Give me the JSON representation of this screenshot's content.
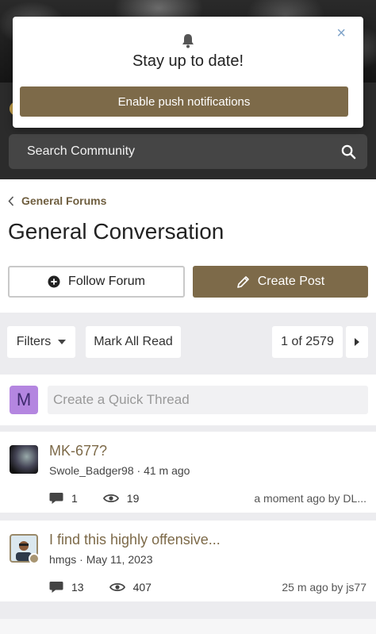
{
  "popup": {
    "title": "Stay up to date!",
    "enable_label": "Enable push notifications",
    "close_glyph": "×"
  },
  "header": {
    "search_label": "Search Community"
  },
  "breadcrumb": {
    "parent": "General Forums"
  },
  "page": {
    "title": "General Conversation"
  },
  "actions": {
    "follow_label": "Follow Forum",
    "create_label": "Create Post"
  },
  "toolbar": {
    "filters_label": "Filters",
    "mark_read_label": "Mark All Read",
    "pagination": "1 of 2579"
  },
  "quick_thread": {
    "avatar_letter": "M",
    "placeholder": "Create a Quick Thread"
  },
  "threads": [
    {
      "title": "MK-677?",
      "author": "Swole_Badger98",
      "time": "41 m ago",
      "replies": "1",
      "views": "19",
      "last_activity": "a moment ago by DL..."
    },
    {
      "title": "I find this highly offensive...",
      "author": "hmgs",
      "time": "May 11, 2023",
      "replies": "13",
      "views": "407",
      "last_activity": "25 m ago by js77"
    }
  ],
  "colors": {
    "accent": "#7d6a49",
    "header_bg": "#2b2b2b",
    "search_bg": "#454545",
    "avatar_m": "#b486e0"
  }
}
